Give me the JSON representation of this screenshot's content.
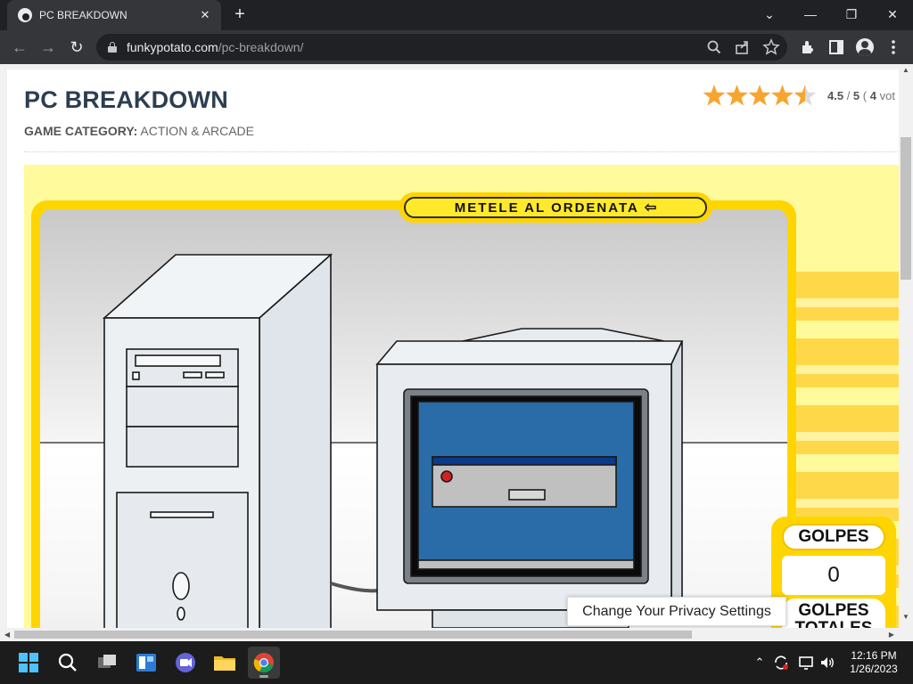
{
  "browser": {
    "tab_title": "PC BREAKDOWN",
    "tab_close": "✕",
    "new_tab": "+",
    "url_domain": "funkypotato.com",
    "url_path": "/pc-breakdown/",
    "window_controls": {
      "list": "⌄",
      "minimize": "—",
      "restore": "❐",
      "close": "✕"
    },
    "nav": {
      "back": "←",
      "forward": "→",
      "reload": "↻"
    }
  },
  "page": {
    "title": "PC BREAKDOWN",
    "category_label": "GAME CATEGORY:",
    "category_value": "ACTION & ARCADE",
    "rating": {
      "value": "4.5",
      "max": "5",
      "votes": "4",
      "stars_filled": 4.5,
      "paren": "(",
      "votes_suffix": "vot",
      "star_color": "#f7a531"
    }
  },
  "game": {
    "banner": "METELE AL ORDENATA",
    "banner_arrow": "⇦",
    "score_label": "GOLPES",
    "score_value": "0",
    "total_label": "GOLPES TOTALES",
    "accent": "#ffd500"
  },
  "privacy_button": "Change Your Privacy Settings",
  "taskbar": {
    "time": "12:16 PM",
    "date": "1/26/2023",
    "tray_up": "⌃"
  }
}
